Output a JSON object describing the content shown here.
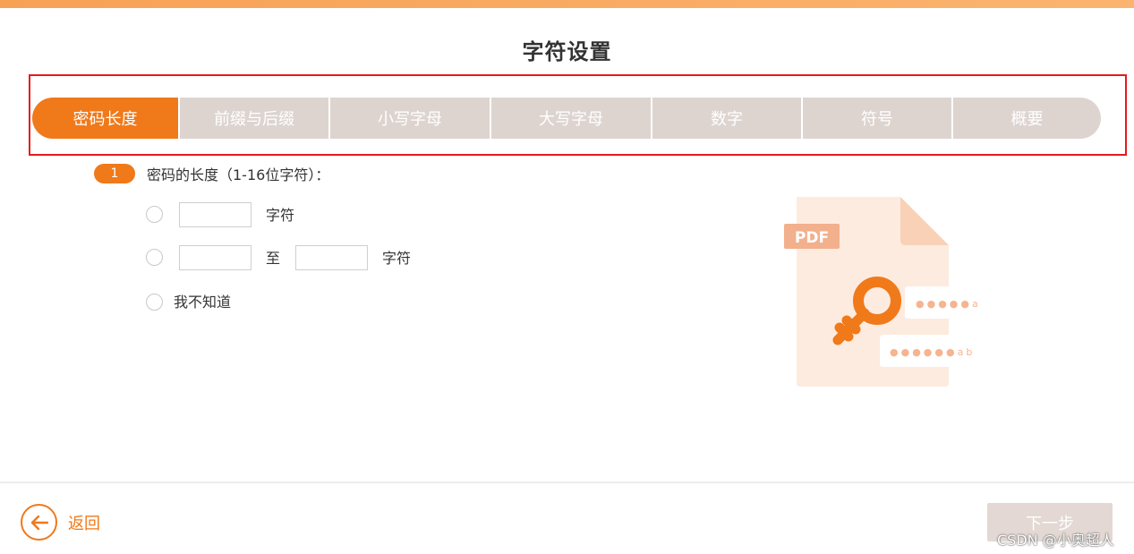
{
  "page": {
    "title": "字符设置"
  },
  "tabs": [
    {
      "label": "密码长度",
      "active": true
    },
    {
      "label": "前缀与后缀",
      "active": false
    },
    {
      "label": "小写字母",
      "active": false
    },
    {
      "label": "大写字母",
      "active": false
    },
    {
      "label": "数字",
      "active": false
    },
    {
      "label": "符号",
      "active": false
    },
    {
      "label": "概要",
      "active": false
    }
  ],
  "step": {
    "number": "1",
    "label": "密码的长度（1-16位字符）："
  },
  "options": {
    "exact": {
      "unit": "字符",
      "value": ""
    },
    "range": {
      "to_label": "至",
      "unit": "字符",
      "from_value": "",
      "to_value": ""
    },
    "unknown": {
      "label": "我不知道"
    }
  },
  "illustration": {
    "badge": "PDF",
    "mask1": "●●●●●a",
    "mask2": "●●●●●●ab"
  },
  "footer": {
    "back_label": "返回",
    "next_label": "下一步"
  },
  "watermark": "CSDN @小奥超人",
  "colors": {
    "accent": "#f0791a",
    "tab_inactive": "#ddd4d0",
    "next_disabled": "#e3d8d3",
    "highlight_frame": "#e81919"
  }
}
